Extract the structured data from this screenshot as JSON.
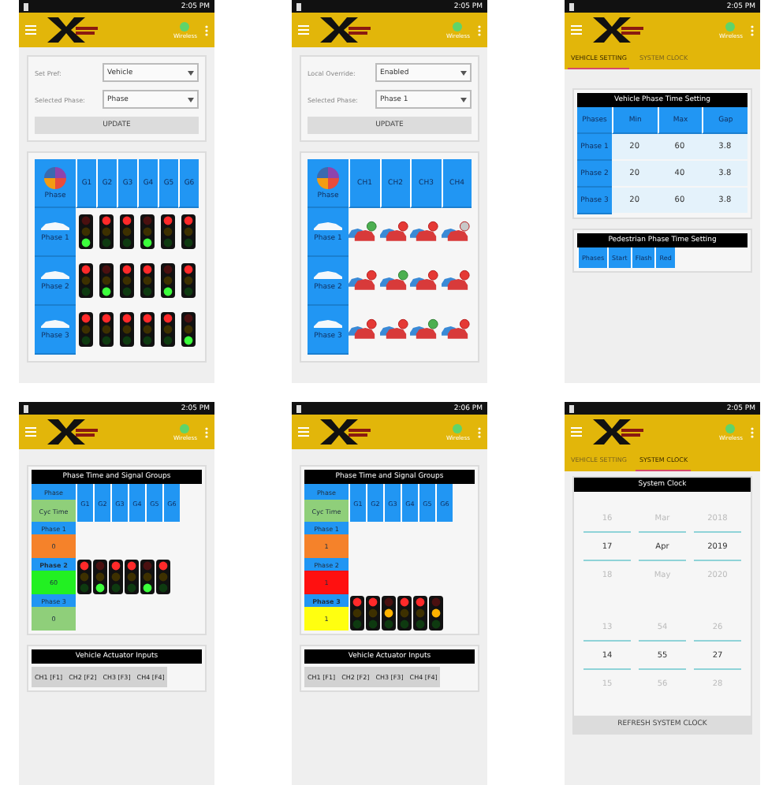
{
  "screens": [
    {
      "kind": "control",
      "status_time": "2:05 PM",
      "status_label": "Wireless",
      "form": {
        "fields": [
          {
            "label": "Set Pref:",
            "value": "Vehicle"
          },
          {
            "label": "Selected Phase:",
            "value": "Phase"
          }
        ],
        "button": "UPDATE"
      },
      "grid": {
        "corner": "Phase",
        "columns": [
          "G1",
          "G2",
          "G3",
          "G4",
          "G5",
          "G6"
        ],
        "rows": [
          {
            "label": "Phase 1",
            "cells": [
              {
                "kind": "light",
                "red": false,
                "amber": false,
                "green": true
              },
              {
                "kind": "light",
                "red": true,
                "amber": false,
                "green": false
              },
              {
                "kind": "light",
                "red": true,
                "amber": false,
                "green": false
              },
              {
                "kind": "light",
                "red": false,
                "amber": false,
                "green": true
              },
              {
                "kind": "light",
                "red": true,
                "amber": false,
                "green": false
              },
              {
                "kind": "light",
                "red": true,
                "amber": false,
                "green": false
              }
            ]
          },
          {
            "label": "Phase 2",
            "cells": [
              {
                "kind": "light",
                "red": true,
                "amber": false,
                "green": false
              },
              {
                "kind": "light",
                "red": false,
                "amber": false,
                "green": true
              },
              {
                "kind": "light",
                "red": true,
                "amber": false,
                "green": false
              },
              {
                "kind": "light",
                "red": true,
                "amber": false,
                "green": false
              },
              {
                "kind": "light",
                "red": false,
                "amber": false,
                "green": true
              },
              {
                "kind": "light",
                "red": true,
                "amber": false,
                "green": false
              }
            ]
          },
          {
            "label": "Phase 3",
            "cells": [
              {
                "kind": "light",
                "red": true,
                "amber": false,
                "green": false
              },
              {
                "kind": "light",
                "red": true,
                "amber": false,
                "green": false
              },
              {
                "kind": "light",
                "red": true,
                "amber": false,
                "green": false
              },
              {
                "kind": "light",
                "red": true,
                "amber": false,
                "green": false
              },
              {
                "kind": "light",
                "red": true,
                "amber": false,
                "green": false
              },
              {
                "kind": "light",
                "red": false,
                "amber": false,
                "green": true
              }
            ]
          }
        ]
      }
    },
    {
      "kind": "control",
      "status_time": "2:05 PM",
      "status_label": "Wireless",
      "form": {
        "fields": [
          {
            "label": "Local Override:",
            "value": "Enabled"
          },
          {
            "label": "Selected Phase:",
            "value": "Phase 1"
          }
        ],
        "button": "UPDATE"
      },
      "grid": {
        "corner": "Phase",
        "columns": [
          "CH1",
          "CH2",
          "CH3",
          "CH4"
        ],
        "rows": [
          {
            "label": "Phase 1",
            "cells": [
              {
                "kind": "car",
                "go": true,
                "disabled": false
              },
              {
                "kind": "car",
                "go": false,
                "disabled": false
              },
              {
                "kind": "car",
                "go": false,
                "disabled": false
              },
              {
                "kind": "car",
                "go": false,
                "disabled": true
              }
            ]
          },
          {
            "label": "Phase 2",
            "cells": [
              {
                "kind": "car",
                "go": false,
                "disabled": false
              },
              {
                "kind": "car",
                "go": true,
                "disabled": false
              },
              {
                "kind": "car",
                "go": false,
                "disabled": false
              },
              {
                "kind": "car",
                "go": false,
                "disabled": false
              }
            ]
          },
          {
            "label": "Phase 3",
            "cells": [
              {
                "kind": "car",
                "go": false,
                "disabled": false
              },
              {
                "kind": "car",
                "go": false,
                "disabled": false
              },
              {
                "kind": "car",
                "go": true,
                "disabled": false
              },
              {
                "kind": "car",
                "go": false,
                "disabled": false
              }
            ]
          }
        ]
      }
    },
    {
      "kind": "timing",
      "status_time": "2:05 PM",
      "status_label": "Wireless",
      "tabs": [
        {
          "label": "VEHICLE SETTING",
          "selected": true
        },
        {
          "label": "SYSTEM CLOCK",
          "selected": false
        }
      ],
      "vehicle_table": {
        "title": "Vehicle Phase Time Setting",
        "columns": [
          "Phases",
          "Min",
          "Max",
          "Gap"
        ],
        "rows": [
          {
            "label": "Phase 1",
            "values": [
              "20",
              "60",
              "3.8"
            ]
          },
          {
            "label": "Phase 2",
            "values": [
              "20",
              "40",
              "3.8"
            ]
          },
          {
            "label": "Phase 3",
            "values": [
              "20",
              "60",
              "3.8"
            ]
          }
        ]
      },
      "pedestrian_table": {
        "title": "Pedestrian Phase Time Setting",
        "columns": [
          "Phases",
          "Start",
          "Flash",
          "Red"
        ]
      }
    },
    {
      "kind": "groups",
      "status_time": "2:05 PM",
      "status_label": "Wireless",
      "signal_groups": {
        "title": "Phase Time and Signal Groups",
        "corner": "Phase",
        "cycle_label": "Cyc Time",
        "columns": [
          "G1",
          "G2",
          "G3",
          "G4",
          "G5",
          "G6"
        ],
        "phases": [
          {
            "label": "Phase 1",
            "value": "0",
            "color": "#f5822a",
            "active": false
          },
          {
            "label": "Phase 2",
            "value": "60",
            "color": "#22f022",
            "active": true
          },
          {
            "label": "Phase 3",
            "value": "0",
            "color": "#8fcf7a",
            "active": false
          }
        ],
        "lights": [
          {
            "red": true,
            "amber": false,
            "green": false
          },
          {
            "red": false,
            "amber": false,
            "green": true
          },
          {
            "red": true,
            "amber": false,
            "green": false
          },
          {
            "red": true,
            "amber": false,
            "green": false
          },
          {
            "red": false,
            "amber": false,
            "green": true
          },
          {
            "red": true,
            "amber": false,
            "green": false
          }
        ]
      },
      "inputs": {
        "title": "Vehicle Actuator Inputs",
        "items": [
          "CH1 [F1]",
          "CH2 [F2]",
          "CH3 [F3]",
          "CH4 [F4]"
        ]
      }
    },
    {
      "kind": "groups",
      "status_time": "2:06 PM",
      "status_label": "Wireless",
      "signal_groups": {
        "title": "Phase Time and Signal Groups",
        "corner": "Phase",
        "cycle_label": "Cyc Time",
        "columns": [
          "G1",
          "G2",
          "G3",
          "G4",
          "G5",
          "G6"
        ],
        "phases": [
          {
            "label": "Phase 1",
            "value": "1",
            "color": "#f5822a",
            "active": false
          },
          {
            "label": "Phase 2",
            "value": "1",
            "color": "#ff1010",
            "active": false
          },
          {
            "label": "Phase 3",
            "value": "1",
            "color": "#ffff10",
            "active": true
          }
        ],
        "lights": [
          {
            "red": true,
            "amber": false,
            "green": false
          },
          {
            "red": true,
            "amber": false,
            "green": false
          },
          {
            "red": false,
            "amber": true,
            "green": false
          },
          {
            "red": true,
            "amber": false,
            "green": false
          },
          {
            "red": true,
            "amber": false,
            "green": false
          },
          {
            "red": false,
            "amber": true,
            "green": false
          }
        ]
      },
      "inputs": {
        "title": "Vehicle Actuator Inputs",
        "items": [
          "CH1 [F1]",
          "CH2 [F2]",
          "CH3 [F3]",
          "CH4 [F4]"
        ]
      }
    },
    {
      "kind": "clock",
      "status_time": "2:05 PM",
      "status_label": "Wireless",
      "tabs": [
        {
          "label": "VEHICLE SETTING",
          "selected": false
        },
        {
          "label": "SYSTEM CLOCK",
          "selected": true
        }
      ],
      "clock": {
        "title": "System Clock",
        "pickers": [
          {
            "columns": [
              [
                {
                  "text": "16",
                  "selected": false
                },
                {
                  "text": "17",
                  "selected": true
                },
                {
                  "text": "18",
                  "selected": false
                }
              ],
              [
                {
                  "text": "Mar",
                  "selected": false
                },
                {
                  "text": "Apr",
                  "selected": true
                },
                {
                  "text": "May",
                  "selected": false
                }
              ],
              [
                {
                  "text": "2018",
                  "selected": false
                },
                {
                  "text": "2019",
                  "selected": true
                },
                {
                  "text": "2020",
                  "selected": false
                }
              ]
            ]
          },
          {
            "columns": [
              [
                {
                  "text": "13",
                  "selected": false
                },
                {
                  "text": "14",
                  "selected": true
                },
                {
                  "text": "15",
                  "selected": false
                }
              ],
              [
                {
                  "text": "54",
                  "selected": false
                },
                {
                  "text": "55",
                  "selected": true
                },
                {
                  "text": "56",
                  "selected": false
                }
              ],
              [
                {
                  "text": "26",
                  "selected": false
                },
                {
                  "text": "27",
                  "selected": true
                },
                {
                  "text": "28",
                  "selected": false
                }
              ]
            ]
          }
        ],
        "button": "REFRESH SYSTEM CLOCK"
      }
    }
  ]
}
